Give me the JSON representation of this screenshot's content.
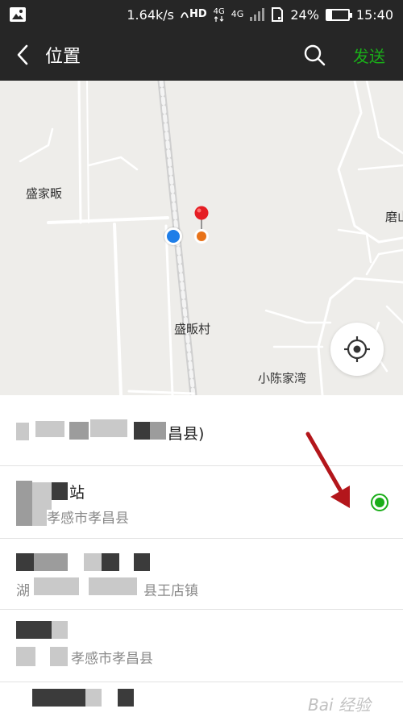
{
  "status_bar": {
    "network_speed": "1.64k/s",
    "hd_label": "HD",
    "network_type_1": "4G",
    "network_type_2": "4G",
    "battery": "24%",
    "battery_level": 0.24,
    "time": "15:40"
  },
  "header": {
    "title": "位置",
    "send_label": "发送"
  },
  "map": {
    "places": [
      "盛家畈",
      "盛畈村",
      "小陈家湾",
      "磨山"
    ]
  },
  "locations": [
    {
      "name": "昌县)",
      "address": "",
      "selected": false
    },
    {
      "name": "站",
      "address": "孝感市孝昌县",
      "selected": true
    },
    {
      "name": "",
      "address_prefix": "湖",
      "address": "县王店镇",
      "selected": false
    },
    {
      "name": "",
      "address": "孝感市孝昌县",
      "selected": false
    }
  ],
  "watermark": "Bai 经验",
  "colors": {
    "header_bg": "#262626",
    "send": "#1aad19",
    "selected": "#1aad19",
    "map_bg": "#eeedea",
    "my_location": "#1e7ee8"
  },
  "icons": [
    "gallery-icon",
    "signal-icon",
    "battery-icon",
    "back-icon",
    "search-icon",
    "location-pin-icon",
    "my-location-dot",
    "locate-icon",
    "selected-radio-icon",
    "red-arrow-annotation"
  ]
}
